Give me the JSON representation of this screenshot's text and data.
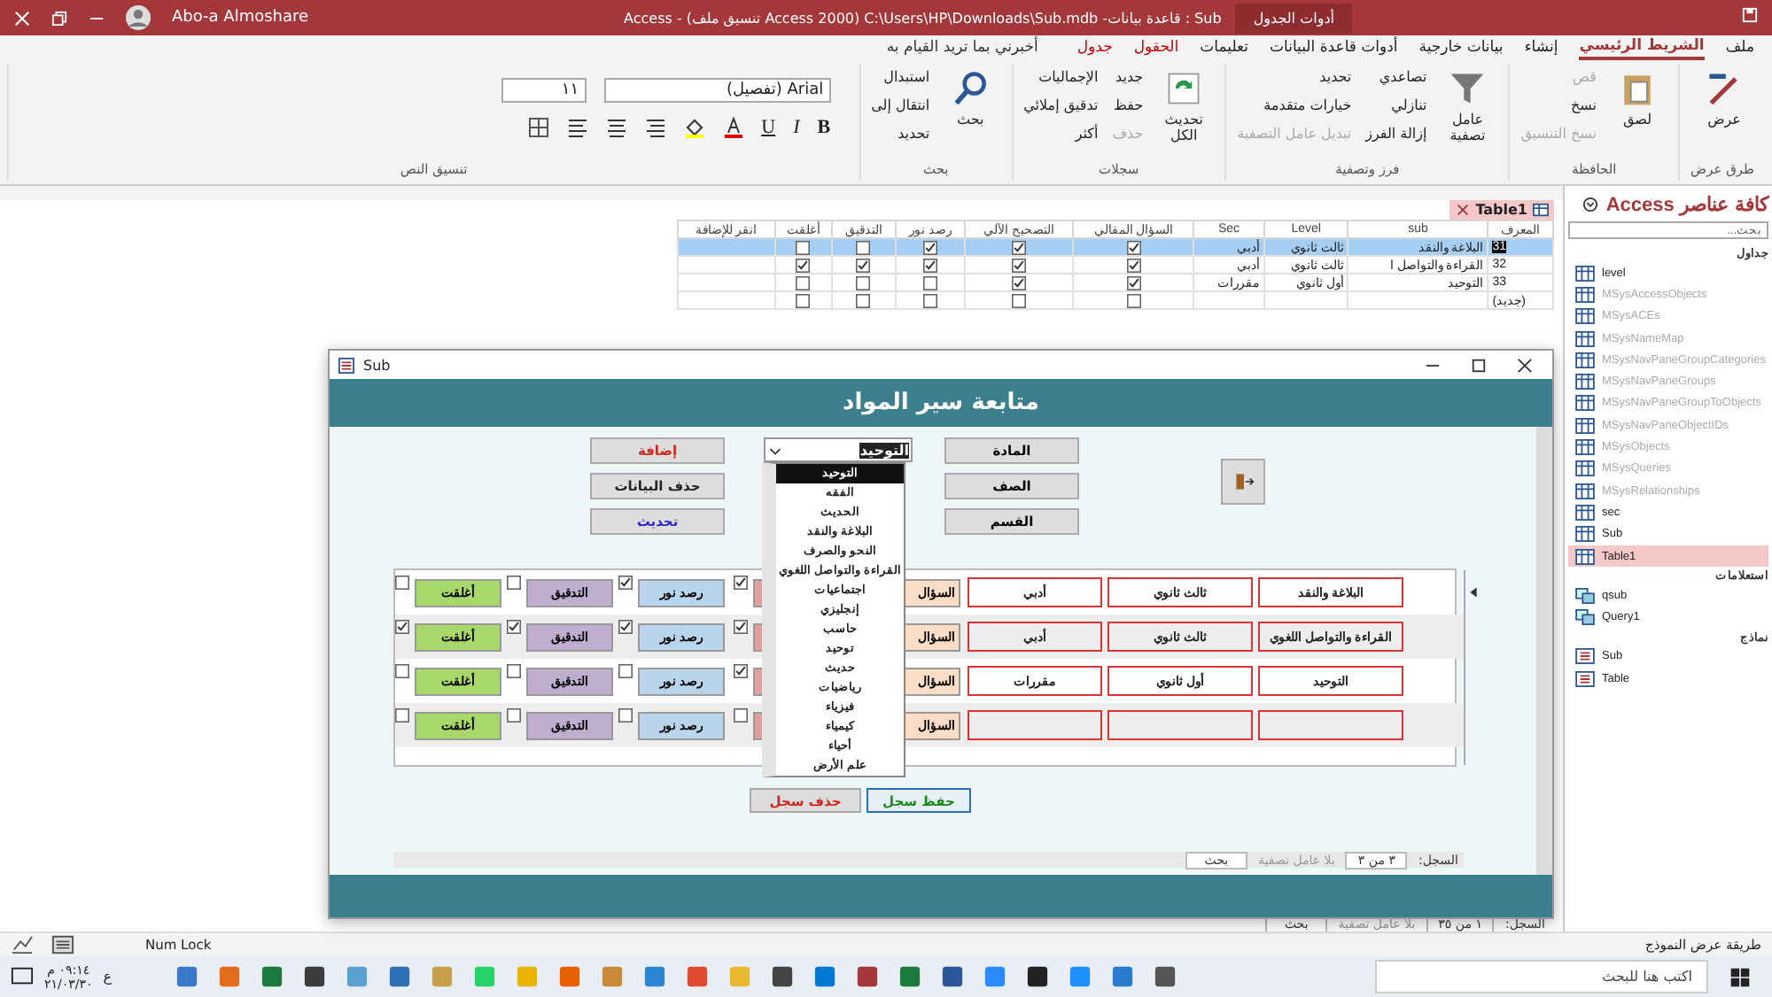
{
  "title_bar": {
    "user": "Abo-a Almoshare",
    "title": "Sub : قاعدة بيانات- C:\\Users\\HP\\Downloads\\Sub.mdb (Access 2000 تنسيق ملف) - Access",
    "context": "أدوات الجدول"
  },
  "ribbon_tabs": [
    {
      "label": "ملف",
      "selected": false,
      "context": false
    },
    {
      "label": "الشريط الرئيسي",
      "selected": true,
      "context": false
    },
    {
      "label": "إنشاء",
      "selected": false,
      "context": false
    },
    {
      "label": "بيانات خارجية",
      "selected": false,
      "context": false
    },
    {
      "label": "أدوات قاعدة البيانات",
      "selected": false,
      "context": false
    },
    {
      "label": "تعليمات",
      "selected": false,
      "context": false
    },
    {
      "label": "الحقول",
      "selected": false,
      "context": true
    },
    {
      "label": "جدول",
      "selected": false,
      "context": true
    }
  ],
  "tell_me": "أخبرني بما تريد القيام به",
  "ribbon_groups": [
    {
      "name": "طرق عرض",
      "large": [
        {
          "label": "عرض",
          "disabled": false
        }
      ]
    },
    {
      "name": "الحافظة",
      "large": [
        {
          "label": "لصق",
          "disabled": false
        }
      ],
      "small": [
        {
          "label": "قص",
          "disabled": true
        },
        {
          "label": "نسخ",
          "disabled": false
        },
        {
          "label": "نسخ التنسيق",
          "disabled": true
        }
      ]
    },
    {
      "name": "فرز وتصفية",
      "large": [
        {
          "label": "عامل تصفية",
          "disabled": false
        }
      ],
      "small": [
        {
          "label": "تصاعدي",
          "disabled": false
        },
        {
          "label": "تنازلي",
          "disabled": false
        },
        {
          "label": "إزالة الفرز",
          "disabled": false
        },
        {
          "label": "تحديد",
          "disabled": false
        },
        {
          "label": "خيارات متقدمة",
          "disabled": false
        },
        {
          "label": "تبديل عامل التصفية",
          "disabled": true
        }
      ]
    },
    {
      "name": "سجلات",
      "large": [
        {
          "label": "تحديث الكل",
          "disabled": false
        }
      ],
      "small": [
        {
          "label": "جديد",
          "disabled": false
        },
        {
          "label": "حفظ",
          "disabled": false
        },
        {
          "label": "حذف",
          "disabled": true
        },
        {
          "label": "الإجماليات",
          "disabled": false
        },
        {
          "label": "تدقيق إملائي",
          "disabled": false
        },
        {
          "label": "أكثر",
          "disabled": false
        }
      ]
    },
    {
      "name": "بحث",
      "large": [
        {
          "label": "بحث",
          "disabled": false
        }
      ],
      "small": [
        {
          "label": "استبدال",
          "disabled": false
        },
        {
          "label": "انتقال إلى",
          "disabled": false
        },
        {
          "label": "تحديد",
          "disabled": false
        }
      ]
    }
  ],
  "text_format": {
    "name": "تنسيق النص",
    "font": "Arial (تفصيل)",
    "size": "١١",
    "styles": [
      "B",
      "I",
      "U"
    ]
  },
  "document_tab": {
    "label": "Table1"
  },
  "datasheet": {
    "columns": [
      "المعرف",
      "sub",
      "Level",
      "Sec",
      "السؤال المقالي",
      "التصحيح الآلي",
      "رصد نور",
      "التدقيق",
      "أغلقت",
      "انقر للإضافة"
    ],
    "rows": [
      {
        "id": "31",
        "sub": "البلاغة والنقد",
        "level": "ثالث ثانوي",
        "sec": "أدبي",
        "checks": [
          true,
          true,
          true,
          false,
          false
        ],
        "selected": true
      },
      {
        "id": "32",
        "sub": "القراءة والتواصل ا",
        "level": "ثالث ثانوي",
        "sec": "أدبي",
        "checks": [
          true,
          true,
          true,
          true,
          true
        ],
        "selected": false
      },
      {
        "id": "33",
        "sub": "التوحيد",
        "level": "أول ثانوي",
        "sec": "مقررات",
        "checks": [
          true,
          true,
          false,
          false,
          false
        ],
        "selected": false
      },
      {
        "id": "(جديد)",
        "checks": [
          false,
          false,
          false,
          false,
          false
        ],
        "selected": false
      }
    ],
    "navigator": {
      "label": "السجل:",
      "position": "١ من ٣٥",
      "filter": "بلا عامل تصفية",
      "search": "بحث"
    }
  },
  "nav_pane": {
    "title": "كافة عناصر Access",
    "search_placeholder": "بحث...",
    "groups": [
      {
        "name": "جداول",
        "kind": "table",
        "items": [
          {
            "label": "level",
            "dimmed": false,
            "selected": false
          },
          {
            "label": "MSysAccessObjects",
            "dimmed": true,
            "selected": false
          },
          {
            "label": "MSysACEs",
            "dimmed": true,
            "selected": false
          },
          {
            "label": "MSysNameMap",
            "dimmed": true,
            "selected": false
          },
          {
            "label": "MSysNavPaneGroupCategories",
            "dimmed": true,
            "selected": false
          },
          {
            "label": "MSysNavPaneGroups",
            "dimmed": true,
            "selected": false
          },
          {
            "label": "MSysNavPaneGroupToObjects",
            "dimmed": true,
            "selected": false
          },
          {
            "label": "MSysNavPaneObjectIDs",
            "dimmed": true,
            "selected": false
          },
          {
            "label": "MSysObjects",
            "dimmed": true,
            "selected": false
          },
          {
            "label": "MSysQueries",
            "dimmed": true,
            "selected": false
          },
          {
            "label": "MSysRelationships",
            "dimmed": true,
            "selected": false
          },
          {
            "label": "sec",
            "dimmed": false,
            "selected": false
          },
          {
            "label": "Sub",
            "dimmed": false,
            "selected": false
          },
          {
            "label": "Table1",
            "dimmed": false,
            "selected": true
          }
        ]
      },
      {
        "name": "استعلامات",
        "kind": "query",
        "items": [
          {
            "label": "qsub",
            "dimmed": false,
            "selected": false
          },
          {
            "label": "Query1",
            "dimmed": false,
            "selected": false
          }
        ]
      },
      {
        "name": "نماذج",
        "kind": "form",
        "items": [
          {
            "label": "Sub",
            "dimmed": false,
            "selected": false
          },
          {
            "label": "Table",
            "dimmed": false,
            "selected": false
          }
        ]
      }
    ]
  },
  "form_window": {
    "title": "Sub",
    "header": "متابعة سير المواد",
    "actions": [
      {
        "label": "إضافة",
        "color": "#d0261c"
      },
      {
        "label": "حذف البيانات",
        "color": "#222222"
      },
      {
        "label": "تحديث",
        "color": "#2a2ad0"
      }
    ],
    "combo": {
      "value": "التوحيد",
      "options": [
        {
          "label": "التوحيد",
          "selected": true
        },
        {
          "label": "الفقه",
          "selected": false
        },
        {
          "label": "الحديث",
          "selected": false
        },
        {
          "label": "البلاغة والنقد",
          "selected": false
        },
        {
          "label": "النحو والصرف",
          "selected": false
        },
        {
          "label": "القراءة والتواصل اللغوي",
          "selected": false
        },
        {
          "label": "اجتماعيات",
          "selected": false
        },
        {
          "label": "إنجليزي",
          "selected": false
        },
        {
          "label": "حاسب",
          "selected": false
        },
        {
          "label": "توحيد",
          "selected": false
        },
        {
          "label": "حديث",
          "selected": false
        },
        {
          "label": "رياضيات",
          "selected": false
        },
        {
          "label": "فيزياء",
          "selected": false
        },
        {
          "label": "كيمياء",
          "selected": false
        },
        {
          "label": "أحياء",
          "selected": false
        },
        {
          "label": "علم الأرض",
          "selected": false
        }
      ]
    },
    "sort_buttons": [
      "المادة",
      "الصف",
      "القسم"
    ],
    "row_buttons": [
      {
        "color": "#fbdcc4"
      },
      {
        "color": "#e0a0a0"
      },
      {
        "color": "#b9d5ec"
      },
      {
        "color": "#bfaed0"
      },
      {
        "color": "#a8d86a"
      }
    ],
    "records": [
      {
        "sub": "البلاغة والنقد",
        "level": "ثالث ثانوي",
        "sec": "أدبي",
        "question": "السؤال",
        "rasd": "رصد نور",
        "review": "التدقيق",
        "closed": "أغلقت",
        "checks": [
          true,
          true,
          false,
          false
        ]
      },
      {
        "sub": "القراءة والتواصل اللغوي",
        "level": "ثالث ثانوي",
        "sec": "أدبي",
        "question": "السؤال",
        "rasd": "رصد نور",
        "review": "التدقيق",
        "closed": "أغلقت",
        "checks": [
          true,
          true,
          true,
          true
        ]
      },
      {
        "sub": "التوحيد",
        "level": "أول ثانوي",
        "sec": "مقررات",
        "question": "السؤال",
        "rasd": "رصد نور",
        "review": "التدقيق",
        "closed": "أغلقت",
        "checks": [
          true,
          false,
          false,
          false
        ]
      },
      {
        "question": "السؤال",
        "rasd": "رصد نور",
        "review": "التدقيق",
        "closed": "أغلقت",
        "checks": [
          false,
          false,
          false,
          false
        ]
      }
    ],
    "save": {
      "label": "حفظ سجل",
      "color": "#1a8a1a"
    },
    "delete": {
      "label": "حذف سجل",
      "color": "#d0261c"
    },
    "navigator": {
      "label": "السجل:",
      "position": "٣ من ٣",
      "filter": "بلا عامل تصفية",
      "search": "بحث"
    }
  },
  "status_bar": {
    "view": "طريقة عرض النموذج",
    "num_lock": "Num Lock"
  },
  "taskbar": {
    "search_placeholder": "اكتب هنا للبحث",
    "language": "ع",
    "time": "٠٩:١٤ م",
    "date": "٢١/٠٣/٣٠"
  }
}
